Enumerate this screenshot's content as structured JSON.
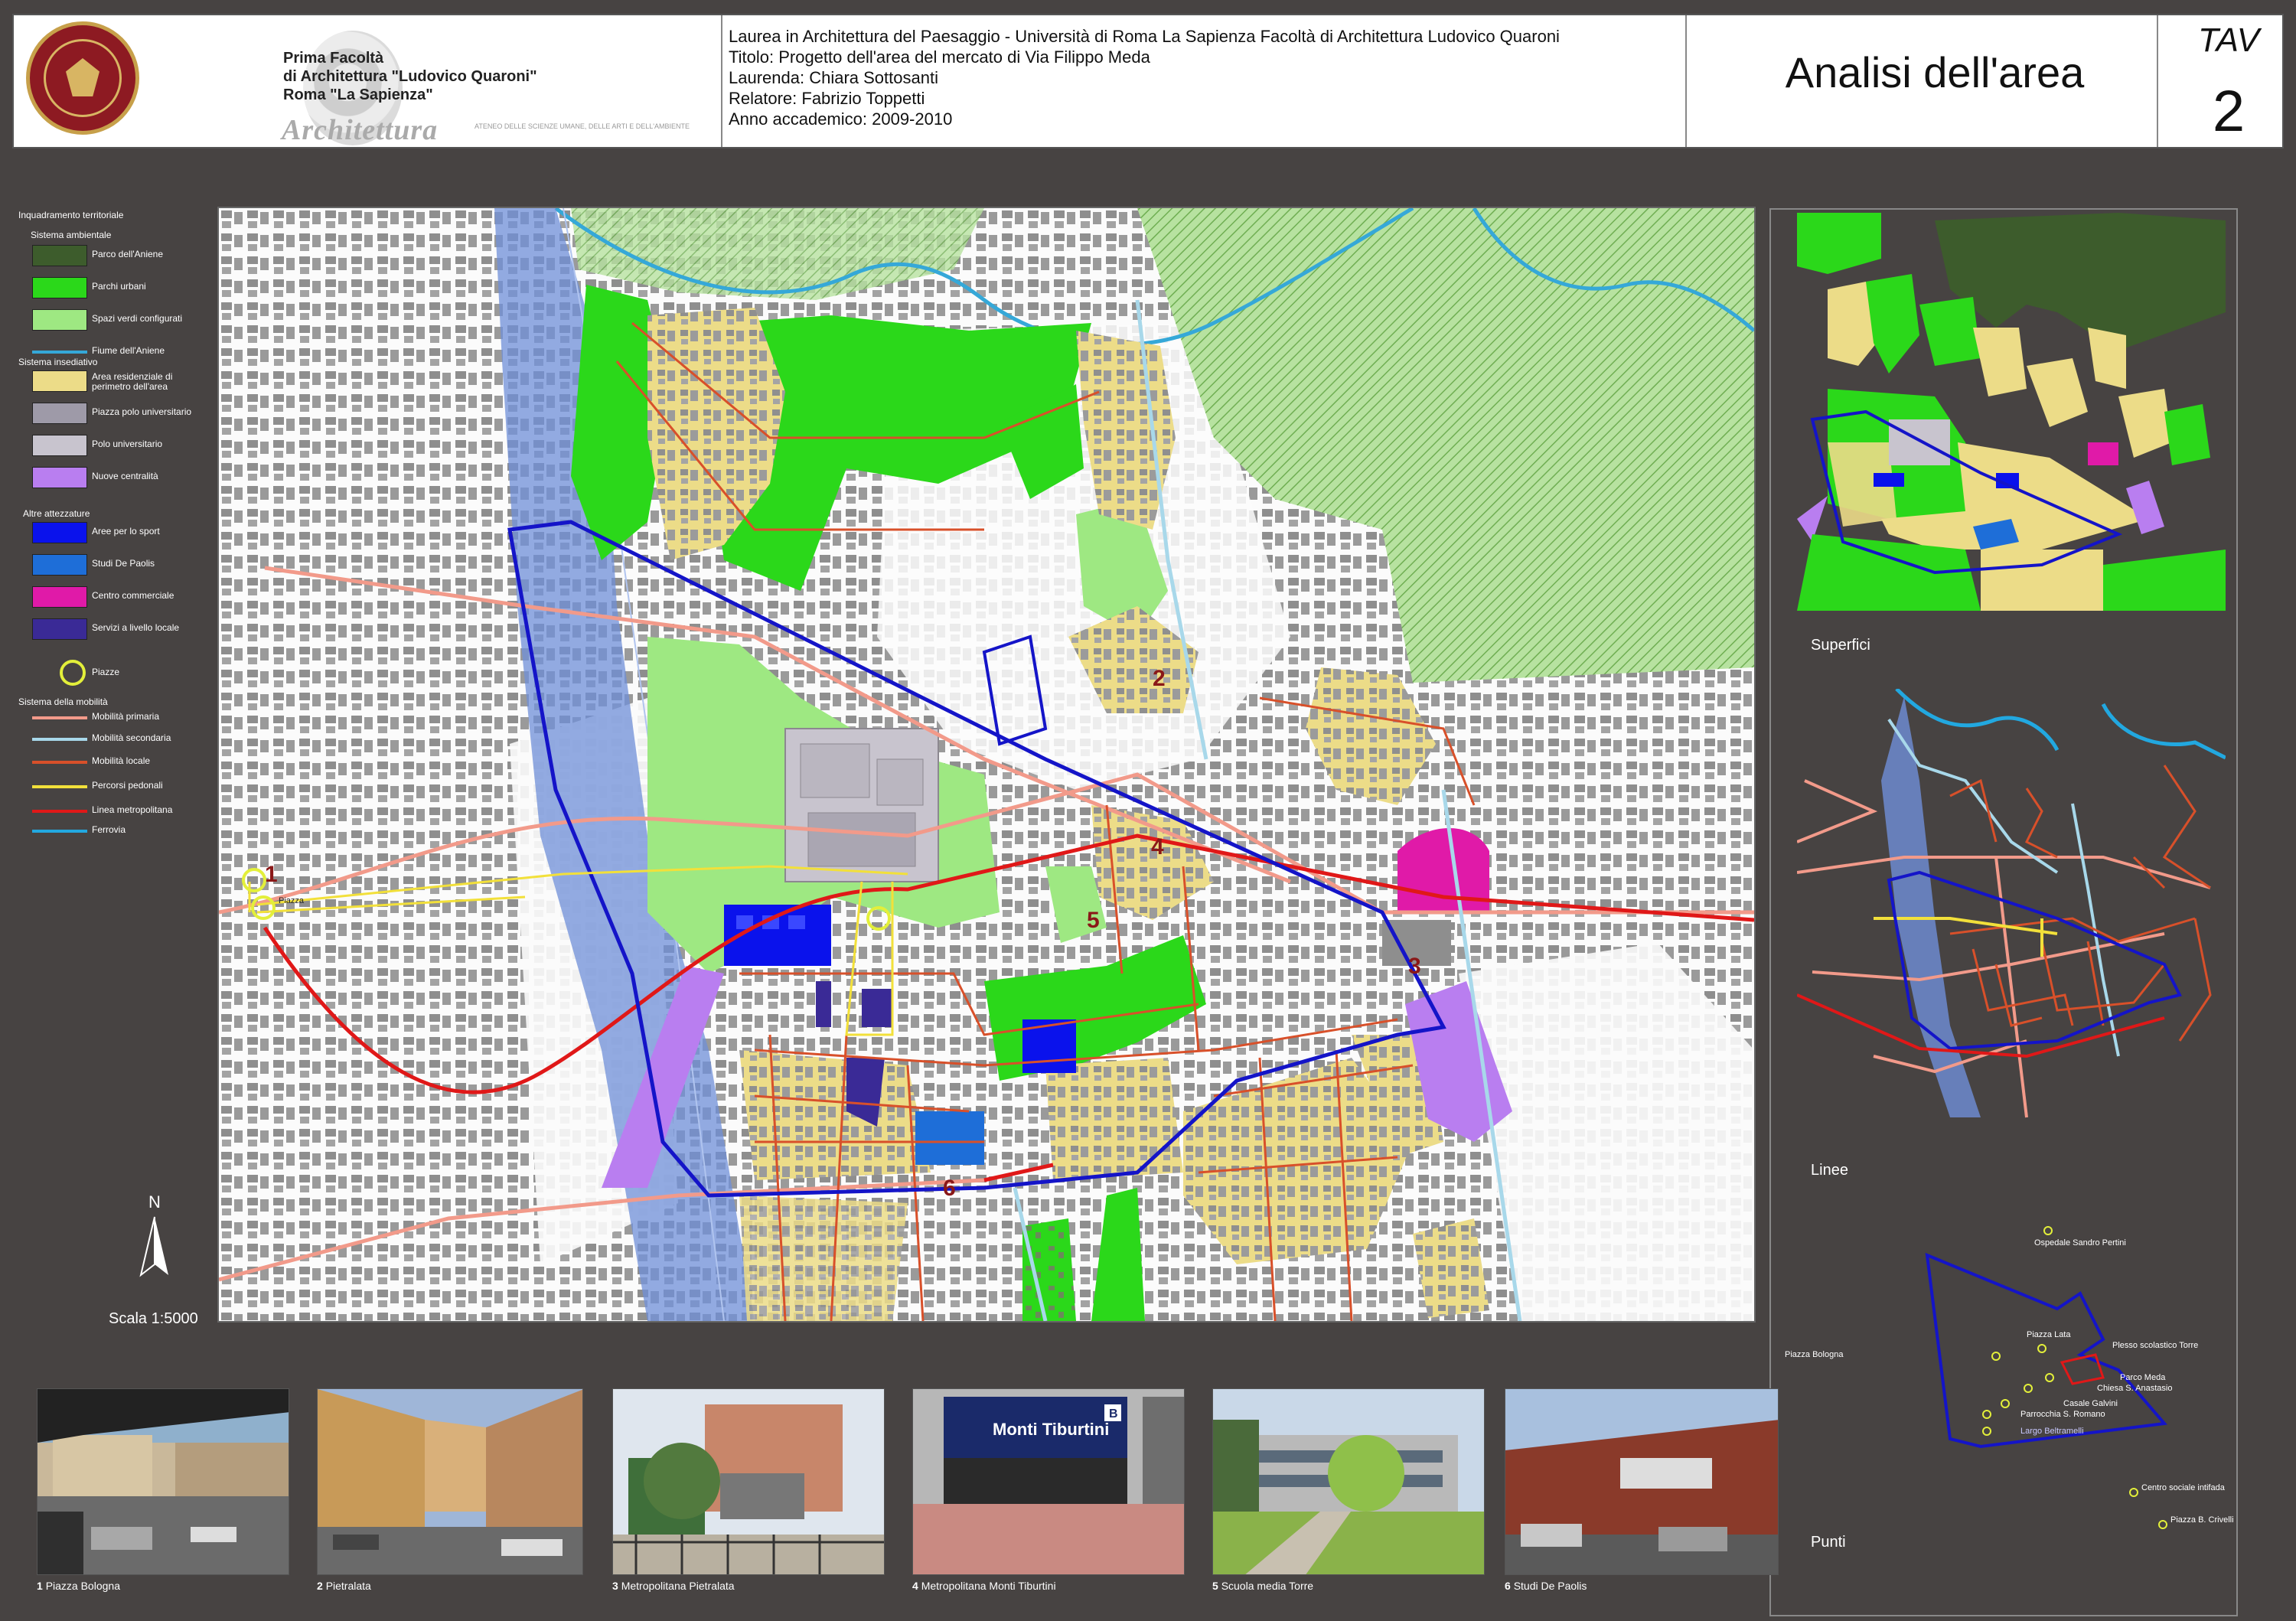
{
  "header": {
    "faculty": [
      "Prima Facoltà",
      "di Architettura \"Ludovico Quaroni\"",
      "Roma \"La Sapienza\""
    ],
    "arch_word": "Architettura",
    "ateneo": "ATENEO DELLE SCIENZE UMANE, DELLE ARTI E DELL'AMBIENTE",
    "info": [
      "Laurea in Architettura del Paesaggio - Università di Roma La Sapienza Facoltà di Architettura Ludovico Quaroni",
      "Titolo: Progetto dell'area del mercato di Via Filippo Meda",
      "Laurenda: Chiara Sottosanti",
      "Relatore: Fabrizio Toppetti",
      "Anno accademico: 2009-2010"
    ],
    "title": "Analisi dell'area",
    "tav_label": "TAV",
    "tav_number": "2"
  },
  "legend": {
    "title": "Inquadramento territoriale",
    "sections": {
      "ambientale": "Sistema ambientale",
      "insediativo": "Sistema insediativo",
      "attrezzature": "Altre attezzature",
      "mobilita": "Sistema della mobilità"
    },
    "items": [
      {
        "label": "Parco dell'Aniene",
        "color": "#3d5c2c"
      },
      {
        "label": "Parchi urbani",
        "color": "#2bd81a"
      },
      {
        "label": "Spazi verdi configurati",
        "color": "#9ee882"
      },
      {
        "label": "Fiume dell'Aniene",
        "color": "#35a8d8"
      },
      {
        "label": "Area residenziale di perimetro dell'area",
        "color": "#ecdc88"
      },
      {
        "label": "Piazza polo universitario",
        "color": "#9e9aa8"
      },
      {
        "label": "Polo universitario",
        "color": "#c8c4ce"
      },
      {
        "label": "Nuove centralità",
        "color": "#b97ef0"
      },
      {
        "label": "Aree per lo sport",
        "color": "#0a12ec"
      },
      {
        "label": "Studi De Paolis",
        "color": "#1e6ed8"
      },
      {
        "label": "Centro commerciale",
        "color": "#e01aa8"
      },
      {
        "label": "Servizi a livello locale",
        "color": "#3a2a96"
      },
      {
        "label": "Piazze",
        "color": "#e3ef3a"
      },
      {
        "label": "Mobilità primaria",
        "color": "#f29a8a"
      },
      {
        "label": "Mobilità secondaria",
        "color": "#a8d8ea"
      },
      {
        "label": "Mobilità locale",
        "color": "#d8502a"
      },
      {
        "label": "Percorsi pedonali",
        "color": "#f2e03a"
      },
      {
        "label": "Linea metropolitana",
        "color": "#e01818"
      },
      {
        "label": "Ferrovia",
        "color": "#22a8e0"
      }
    ]
  },
  "map": {
    "numbers": [
      "1",
      "2",
      "3",
      "4",
      "5",
      "6"
    ],
    "piazza_label": "Piazza"
  },
  "north": "N",
  "scale": "Scala 1:5000",
  "panels": {
    "superfici": "Superfici",
    "linee": "Linee",
    "punti": "Punti"
  },
  "points": [
    "Ospedale Sandro Pertini",
    "Piazza Bologna",
    "Piazza Lata",
    "Plesso scolastico Torre",
    "Parco Meda",
    "Chiesa S. Anastasio",
    "Casale Galvini",
    "Parrocchia S. Romano",
    "Largo Beltramelli",
    "Centro sociale intifada",
    "Piazza B. Crivelli"
  ],
  "photos": [
    {
      "num": "1",
      "caption": "Piazza Bologna"
    },
    {
      "num": "2",
      "caption": "Pietralata"
    },
    {
      "num": "3",
      "caption": "Metropolitana Pietralata"
    },
    {
      "num": "4",
      "caption": "Metropolitana Monti Tiburtini"
    },
    {
      "num": "5",
      "caption": "Scuola media Torre"
    },
    {
      "num": "6",
      "caption": "Studi De Paolis"
    }
  ],
  "photo_signs": {
    "monti_tiburtini": "Monti Tiburtini",
    "metro_sign": "B"
  }
}
